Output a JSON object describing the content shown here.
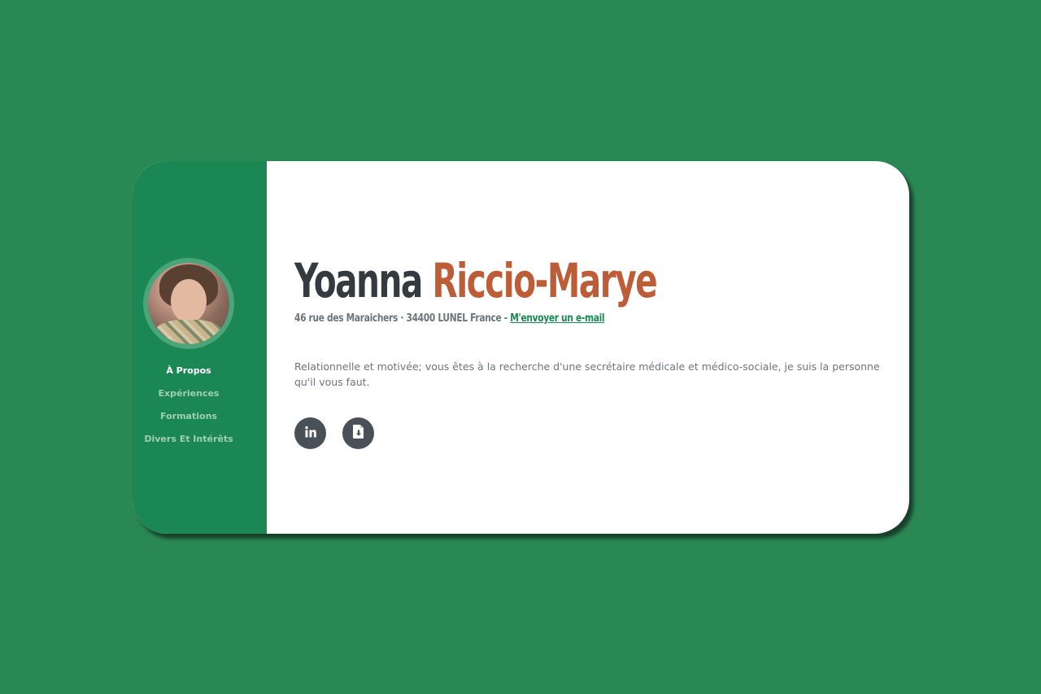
{
  "profile": {
    "first_name": "Yoanna",
    "last_name": "Riccio-Marye",
    "address": "46 rue des Maraichers · 34400 LUNEL France -",
    "email_link": "M'envoyer un e-mail",
    "summary": "Relationnelle et motivée; vous êtes à la recherche d'une secrétaire médicale et médico-sociale, je suis la personne qu'il vous faut."
  },
  "nav": {
    "items": [
      {
        "label": "À Propos",
        "active": true
      },
      {
        "label": "Expériences",
        "active": false
      },
      {
        "label": "Formations",
        "active": false
      },
      {
        "label": "Divers Et Intérêts",
        "active": false
      }
    ]
  },
  "social": {
    "buttons": [
      {
        "icon": "linkedin-icon"
      },
      {
        "icon": "file-download-icon"
      }
    ]
  },
  "colors": {
    "page_background": "#2a8854",
    "sidebar": "#1a8754",
    "accent_last_name": "#bd5d38",
    "dark_text": "#343a40",
    "muted_text": "#6c757d",
    "icon_button": "#495057"
  }
}
